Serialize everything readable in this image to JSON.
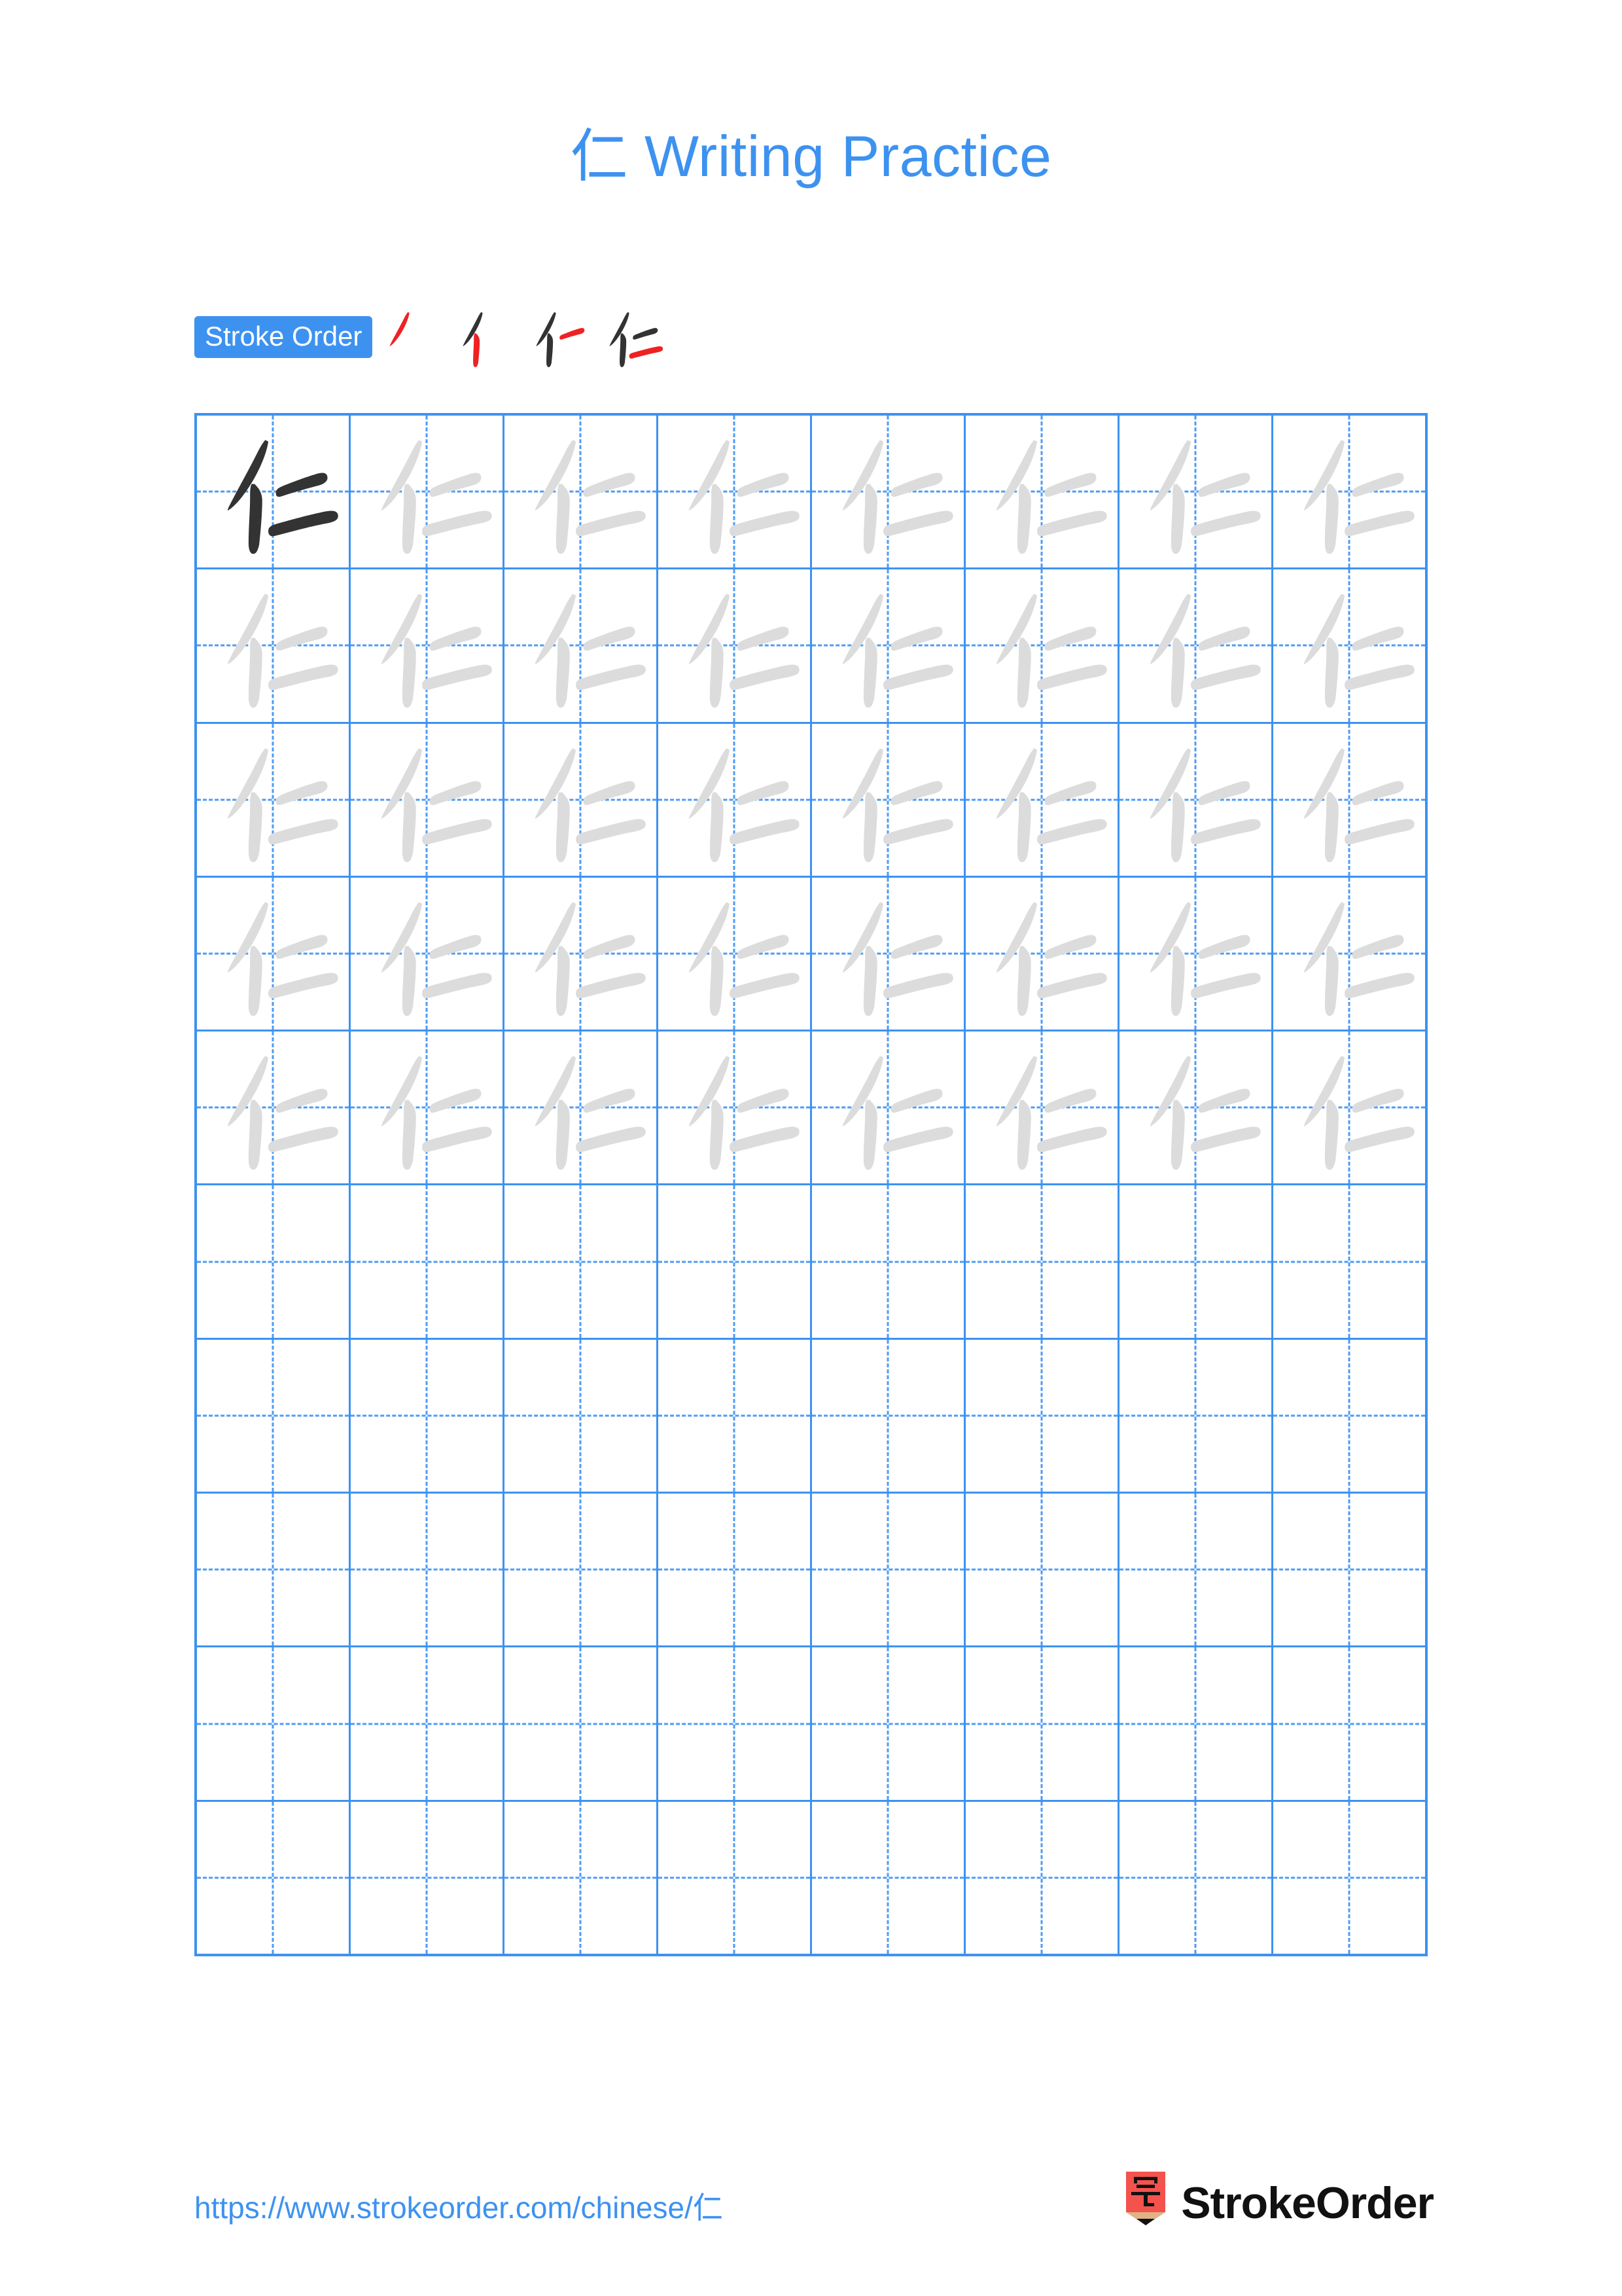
{
  "page": {
    "character": "仁",
    "title_suffix": " Writing Practice",
    "title_full": "仁 Writing Practice",
    "background_color": "#ffffff",
    "accent_color": "#3d92f0",
    "grid_line_color": "#3d92f0",
    "grid_dash_color": "#4d9bf5",
    "model_char_color": "#333333",
    "trace_char_color": "#dcdcdc",
    "new_stroke_color": "#ee2222"
  },
  "stroke_order": {
    "badge_label": "Stroke Order",
    "badge_background": "#3d92f0",
    "badge_text_color": "#ffffff",
    "stroke_count": 4,
    "steps": [
      {
        "index": 1,
        "strokes_shown": 1,
        "new_stroke": 1,
        "name": "pie"
      },
      {
        "index": 2,
        "strokes_shown": 2,
        "new_stroke": 2,
        "name": "shu"
      },
      {
        "index": 3,
        "strokes_shown": 3,
        "new_stroke": 3,
        "name": "heng-upper"
      },
      {
        "index": 4,
        "strokes_shown": 4,
        "new_stroke": 4,
        "name": "heng-lower"
      }
    ]
  },
  "practice_grid": {
    "columns": 8,
    "rows": 10,
    "filled_rows": 5,
    "empty_rows": 5,
    "model_cell": {
      "row": 1,
      "column": 1
    },
    "rows_data": [
      {
        "row": 1,
        "cells": [
          "model",
          "trace",
          "trace",
          "trace",
          "trace",
          "trace",
          "trace",
          "trace"
        ]
      },
      {
        "row": 2,
        "cells": [
          "trace",
          "trace",
          "trace",
          "trace",
          "trace",
          "trace",
          "trace",
          "trace"
        ]
      },
      {
        "row": 3,
        "cells": [
          "trace",
          "trace",
          "trace",
          "trace",
          "trace",
          "trace",
          "trace",
          "trace"
        ]
      },
      {
        "row": 4,
        "cells": [
          "trace",
          "trace",
          "trace",
          "trace",
          "trace",
          "trace",
          "trace",
          "trace"
        ]
      },
      {
        "row": 5,
        "cells": [
          "trace",
          "trace",
          "trace",
          "trace",
          "trace",
          "trace",
          "trace",
          "trace"
        ]
      },
      {
        "row": 6,
        "cells": [
          "empty",
          "empty",
          "empty",
          "empty",
          "empty",
          "empty",
          "empty",
          "empty"
        ]
      },
      {
        "row": 7,
        "cells": [
          "empty",
          "empty",
          "empty",
          "empty",
          "empty",
          "empty",
          "empty",
          "empty"
        ]
      },
      {
        "row": 8,
        "cells": [
          "empty",
          "empty",
          "empty",
          "empty",
          "empty",
          "empty",
          "empty",
          "empty"
        ]
      },
      {
        "row": 9,
        "cells": [
          "empty",
          "empty",
          "empty",
          "empty",
          "empty",
          "empty",
          "empty",
          "empty"
        ]
      },
      {
        "row": 10,
        "cells": [
          "empty",
          "empty",
          "empty",
          "empty",
          "empty",
          "empty",
          "empty",
          "empty"
        ]
      }
    ]
  },
  "footer": {
    "url": "https://www.strokeorder.com/chinese/仁",
    "url_prefix": "https://www.strokeorder.com/chinese/",
    "url_character": "仁",
    "logo_text": "StrokeOrder",
    "logo_icon_character": "字",
    "logo_pencil_color": "#f4524d",
    "logo_tip_color": "#e0b387"
  }
}
